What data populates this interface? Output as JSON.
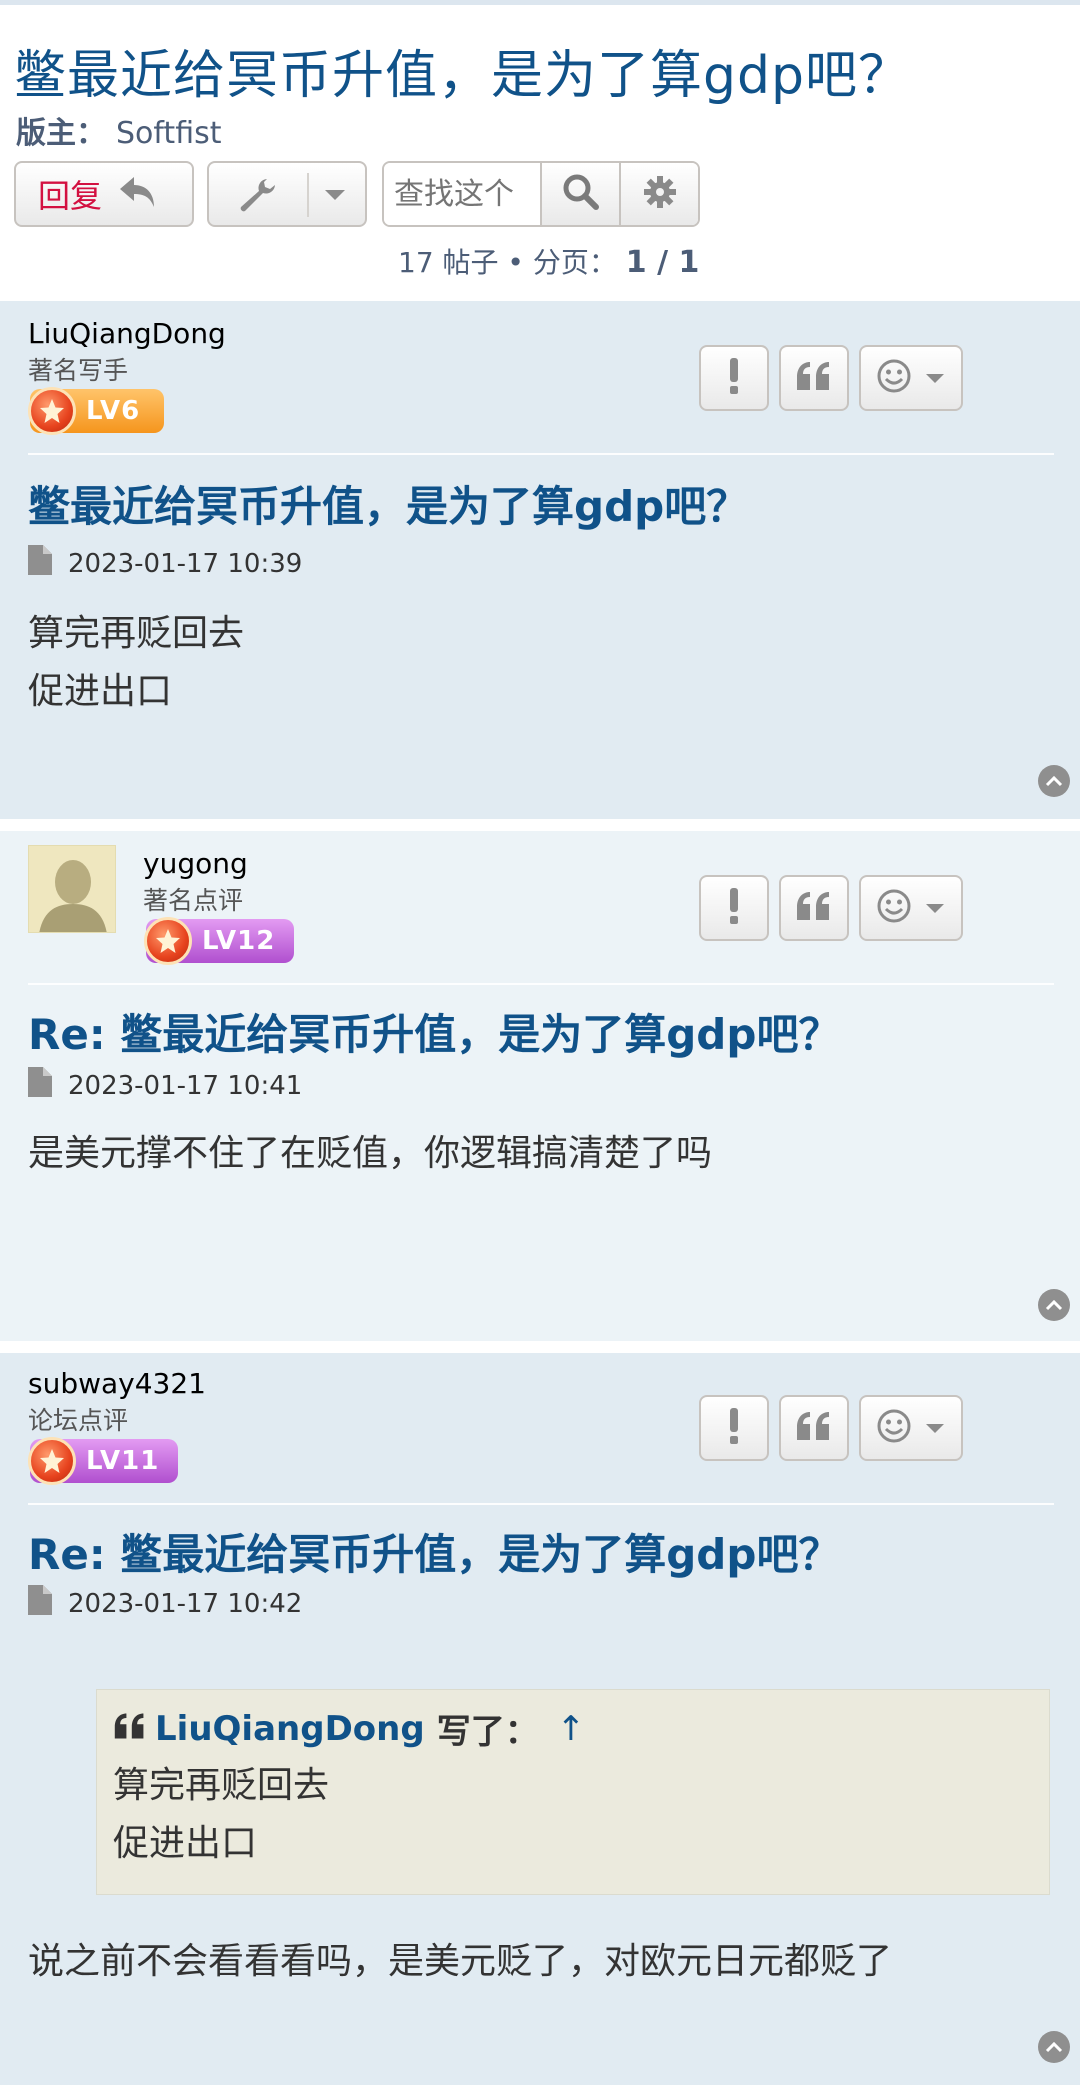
{
  "topic": {
    "title": "鳖最近给冥币升值，是为了算gdp吧？",
    "moderator_label": "版主：",
    "moderator_name": "Softfist"
  },
  "toolbar": {
    "reply_label": "回复",
    "search_placeholder": "查找这个",
    "post_count": "17 帖子",
    "page_label": "分页：",
    "page_value": "1 / 1"
  },
  "posts": [
    {
      "username": "LiuQiangDong",
      "rank": "著名写手",
      "level": "LV6",
      "subject": "鳖最近给冥币升值，是为了算gdp吧？",
      "datetime": "2023-01-17 10:39",
      "lines": [
        "算完再贬回去",
        "促进出口"
      ]
    },
    {
      "username": "yugong",
      "rank": "著名点评",
      "level": "LV12",
      "subject": "Re: 鳖最近给冥币升值，是为了算gdp吧？",
      "datetime": "2023-01-17 10:41",
      "lines": [
        "是美元撑不住了在贬值，你逻辑搞清楚了吗"
      ]
    },
    {
      "username": "subway4321",
      "rank": "论坛点评",
      "level": "LV11",
      "subject": "Re: 鳖最近给冥币升值，是为了算gdp吧？",
      "datetime": "2023-01-17 10:42",
      "quote": {
        "user": "LiuQiangDong",
        "wrote": "写了：",
        "arrow": "↑",
        "lines": [
          "算完再贬回去",
          "促进出口"
        ]
      },
      "lines": [
        "说之前不会看看看吗，是美元贬了，对欧元日元都贬了"
      ]
    }
  ],
  "colors": {
    "title_blue": "#105289",
    "reply_red": "#d31141",
    "post_bg": "#e1ebf2",
    "quote_bg": "#ebeadd"
  }
}
